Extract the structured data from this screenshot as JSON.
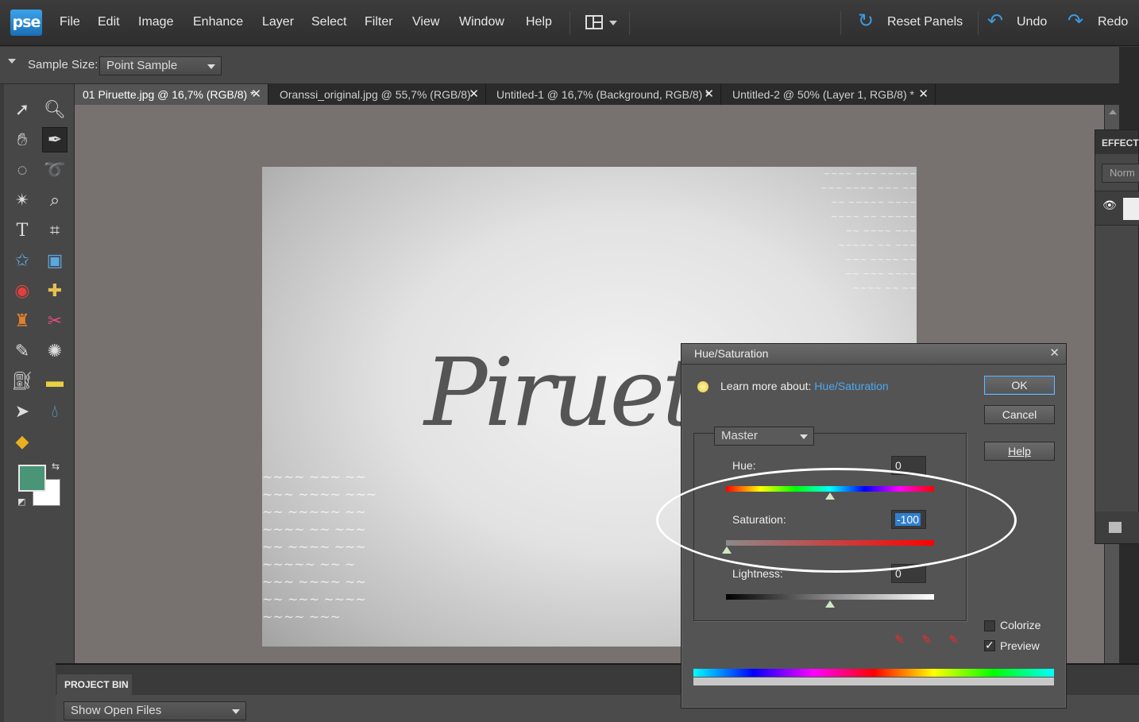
{
  "app": {
    "logo": "pse"
  },
  "menu": [
    "File",
    "Edit",
    "Image",
    "Enhance",
    "Layer",
    "Select",
    "Filter",
    "View",
    "Window",
    "Help"
  ],
  "toolbar": {
    "reset_panels": "Reset Panels",
    "undo": "Undo",
    "redo": "Redo"
  },
  "options": {
    "sample_size_label": "Sample Size:",
    "sample_size_value": "Point Sample"
  },
  "tabs": [
    {
      "label": "01 Piruette.jpg @ 16,7% (RGB/8) *",
      "active": true
    },
    {
      "label": "Oranssi_original.jpg @ 55,7% (RGB/8)",
      "active": false
    },
    {
      "label": "Untitled-1 @ 16,7% (Background, RGB/8) *",
      "active": false
    },
    {
      "label": "Untitled-2 @ 50% (Layer 1, RGB/8) *",
      "active": false
    }
  ],
  "canvas": {
    "title_text": "Piruet"
  },
  "effects_panel": {
    "title": "EFFECTS",
    "blend": "Norm"
  },
  "project_bin": {
    "title": "PROJECT BIN",
    "dropdown": "Show Open Files"
  },
  "dialog": {
    "title": "Hue/Saturation",
    "learn_prefix": "Learn more about:",
    "learn_link": "Hue/Saturation",
    "ok": "OK",
    "cancel": "Cancel",
    "help": "Help",
    "edit": "Master",
    "hue_label": "Hue:",
    "hue_value": "0",
    "saturation_label": "Saturation:",
    "saturation_value": "-100",
    "lightness_label": "Lightness:",
    "lightness_value": "0",
    "colorize": {
      "label": "Colorize",
      "checked": false
    },
    "preview": {
      "label": "Preview",
      "checked": true
    }
  },
  "colors": {
    "foreground": "#4a9478",
    "background": "#ffffff",
    "accent": "#3a9be0",
    "link": "#4aa8f0"
  }
}
